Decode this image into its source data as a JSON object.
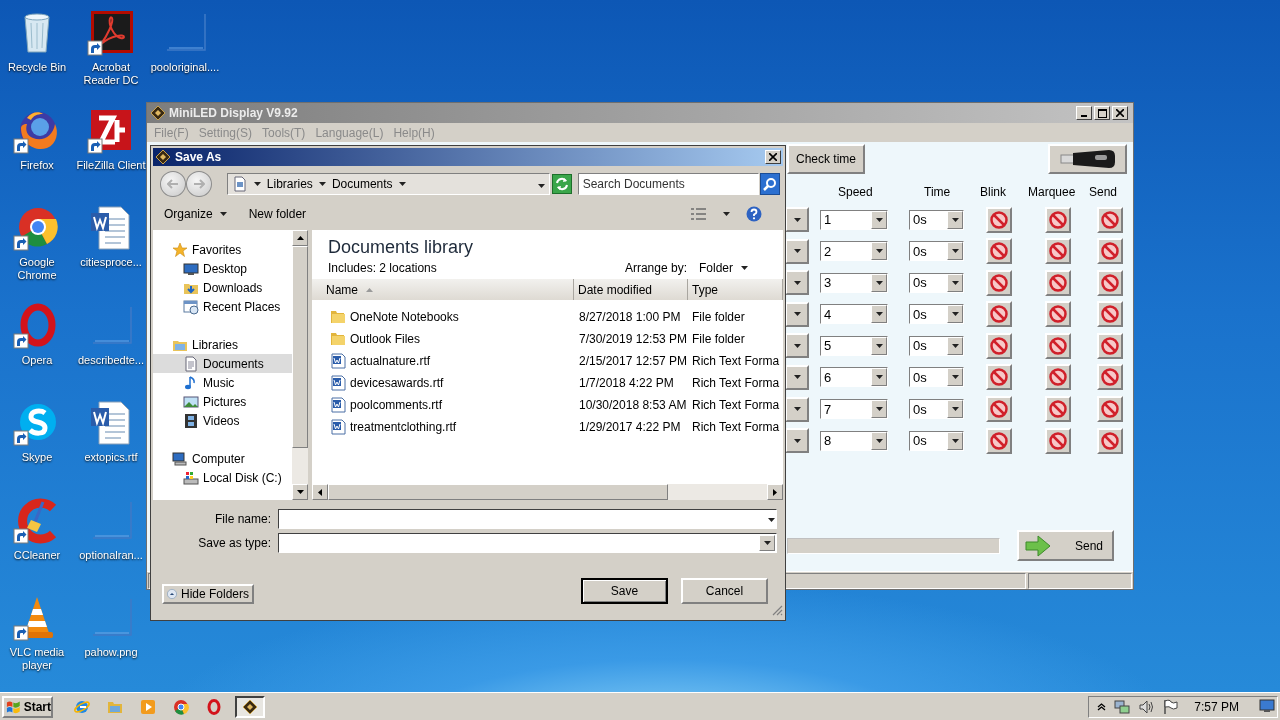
{
  "desktop_icons": [
    {
      "label": "Recycle Bin",
      "kind": "recycle",
      "shortcut": false
    },
    {
      "label": "Firefox",
      "kind": "firefox",
      "shortcut": true
    },
    {
      "label": "Google Chrome",
      "kind": "chrome",
      "shortcut": true
    },
    {
      "label": "Opera",
      "kind": "opera",
      "shortcut": true
    },
    {
      "label": "Skype",
      "kind": "skype",
      "shortcut": true
    },
    {
      "label": "CCleaner",
      "kind": "ccleaner",
      "shortcut": true
    },
    {
      "label": "VLC media player",
      "kind": "vlc",
      "shortcut": true
    },
    {
      "label": "Acrobat Reader DC",
      "kind": "acrobat",
      "shortcut": true
    },
    {
      "label": "FileZilla Client",
      "kind": "filezilla",
      "shortcut": true
    },
    {
      "label": "citiesproce...",
      "kind": "word",
      "shortcut": false
    },
    {
      "label": "describedte...",
      "kind": "blank",
      "shortcut": false
    },
    {
      "label": "extopics.rtf",
      "kind": "word",
      "shortcut": false
    },
    {
      "label": "optionalran...",
      "kind": "blank",
      "shortcut": false
    },
    {
      "label": "pahow.png",
      "kind": "blank",
      "shortcut": false
    },
    {
      "label": "pooloriginal....",
      "kind": "blank",
      "shortcut": false
    }
  ],
  "main_window": {
    "title": "MiniLED Display V9.92",
    "menu": [
      "File(F)",
      "Setting(S)",
      "Tools(T)",
      "Language(L)",
      "Help(H)"
    ],
    "check_time_button": "Check time",
    "columns": [
      "Speed",
      "Time",
      "Blink",
      "Marquee",
      "Send"
    ],
    "rows": [
      {
        "speed": "1",
        "time": "0s"
      },
      {
        "speed": "2",
        "time": "0s"
      },
      {
        "speed": "3",
        "time": "0s"
      },
      {
        "speed": "4",
        "time": "0s"
      },
      {
        "speed": "5",
        "time": "0s"
      },
      {
        "speed": "6",
        "time": "0s"
      },
      {
        "speed": "7",
        "time": "0s"
      },
      {
        "speed": "8",
        "time": "0s"
      }
    ],
    "progress": {
      "level": 0
    },
    "send_button": "Send"
  },
  "dialog": {
    "title": "Save As",
    "breadcrumb": [
      "Libraries",
      "Documents"
    ],
    "search": {
      "placeholder": "Search Documents"
    },
    "toolbar": {
      "organize": "Organize",
      "new_folder": "New folder"
    },
    "nav": [
      {
        "label": "Favorites",
        "kind": "star",
        "selected": false,
        "children": [
          {
            "label": "Desktop",
            "kind": "desktop",
            "selected": false
          },
          {
            "label": "Downloads",
            "kind": "downloads",
            "selected": false
          },
          {
            "label": "Recent Places",
            "kind": "recent",
            "selected": false
          }
        ]
      },
      {
        "label": "Libraries",
        "kind": "library",
        "selected": false,
        "children": [
          {
            "label": "Documents",
            "kind": "documents",
            "selected": true
          },
          {
            "label": "Music",
            "kind": "music",
            "selected": false
          },
          {
            "label": "Pictures",
            "kind": "pictures",
            "selected": false
          },
          {
            "label": "Videos",
            "kind": "videos",
            "selected": false
          }
        ]
      },
      {
        "label": "Computer",
        "kind": "computer",
        "selected": false,
        "children": [
          {
            "label": "Local Disk (C:)",
            "kind": "disk",
            "selected": false
          }
        ]
      }
    ],
    "library": {
      "title": "Documents library",
      "includes": "Includes:  2 locations",
      "arrange_label": "Arrange by:",
      "arrange_value": "Folder"
    },
    "columns": [
      "Name",
      "Date modified",
      "Type"
    ],
    "files": [
      {
        "name": "OneNote Notebooks",
        "kind": "folder",
        "date": "8/27/2018 1:00 PM",
        "type": "File folder"
      },
      {
        "name": "Outlook Files",
        "kind": "folder",
        "date": "7/30/2019 12:53 PM",
        "type": "File folder"
      },
      {
        "name": "actualnature.rtf",
        "kind": "rtf",
        "date": "2/15/2017 12:57 PM",
        "type": "Rich Text Forma"
      },
      {
        "name": "devicesawards.rtf",
        "kind": "rtf",
        "date": "1/7/2018 4:22 PM",
        "type": "Rich Text Forma"
      },
      {
        "name": "poolcomments.rtf",
        "kind": "rtf",
        "date": "10/30/2018 8:53 AM",
        "type": "Rich Text Forma"
      },
      {
        "name": "treatmentclothing.rtf",
        "kind": "rtf",
        "date": "1/29/2017 4:22 PM",
        "type": "Rich Text Forma"
      }
    ],
    "file_name_label": "File name:",
    "save_type_label": "Save as type:",
    "hide_folders": "Hide Folders",
    "buttons": [
      "Save",
      "Cancel"
    ]
  },
  "taskbar": {
    "start": "Start",
    "apps": [
      {
        "kind": "ie",
        "selected": false
      },
      {
        "kind": "explorer",
        "selected": false
      },
      {
        "kind": "media",
        "selected": false
      },
      {
        "kind": "chrome",
        "selected": false
      },
      {
        "kind": "opera",
        "selected": false
      },
      {
        "kind": "miniled",
        "selected": true
      }
    ],
    "clock": "7:57 PM"
  }
}
